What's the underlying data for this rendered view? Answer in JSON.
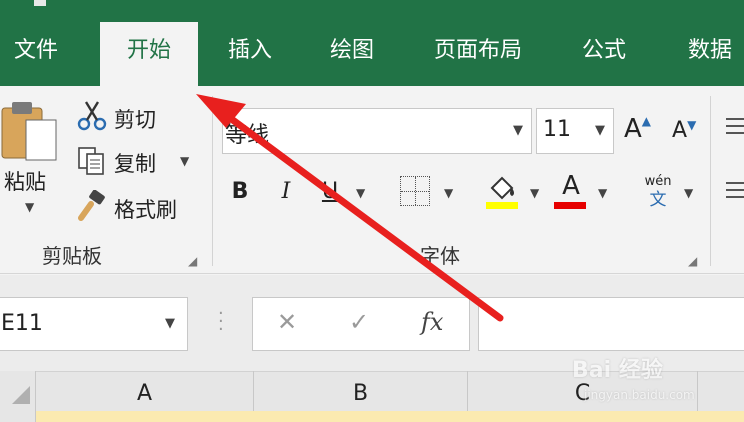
{
  "colors": {
    "accent": "#217346",
    "arrow": "#e8201e",
    "highlight_yellow": "#ffff00",
    "font_red": "#e60000",
    "cell_fill": "#fbeab0"
  },
  "tabs": [
    {
      "label": "文件",
      "active": false
    },
    {
      "label": "开始",
      "active": true
    },
    {
      "label": "插入",
      "active": false
    },
    {
      "label": "绘图",
      "active": false
    },
    {
      "label": "页面布局",
      "active": false
    },
    {
      "label": "公式",
      "active": false
    },
    {
      "label": "数据",
      "active": false
    }
  ],
  "clipboard": {
    "paste_label": "粘贴",
    "cut_label": "剪切",
    "copy_label": "复制",
    "format_painter_label": "格式刷",
    "group_label": "剪贴板"
  },
  "font": {
    "font_name": "等线",
    "font_size": "11",
    "group_label": "字体",
    "grow_label": "A",
    "shrink_label": "A",
    "bold_label": "B",
    "italic_label": "I",
    "underline_label": "U",
    "font_color_label": "A",
    "phonetic_top": "wén",
    "phonetic_bottom": "文"
  },
  "formula_bar": {
    "name_box": "E11",
    "cancel_symbol": "✕",
    "enter_symbol": "✓",
    "fx_label": "fx"
  },
  "columns": [
    "A",
    "B",
    "C"
  ],
  "icons": [
    "scissors-icon",
    "copy-icon",
    "format-painter-icon",
    "clipboard-icon",
    "border-icon",
    "fill-color-icon"
  ],
  "watermark": {
    "brand": "Bai 经验",
    "url": "jingyan.baidu.com"
  }
}
